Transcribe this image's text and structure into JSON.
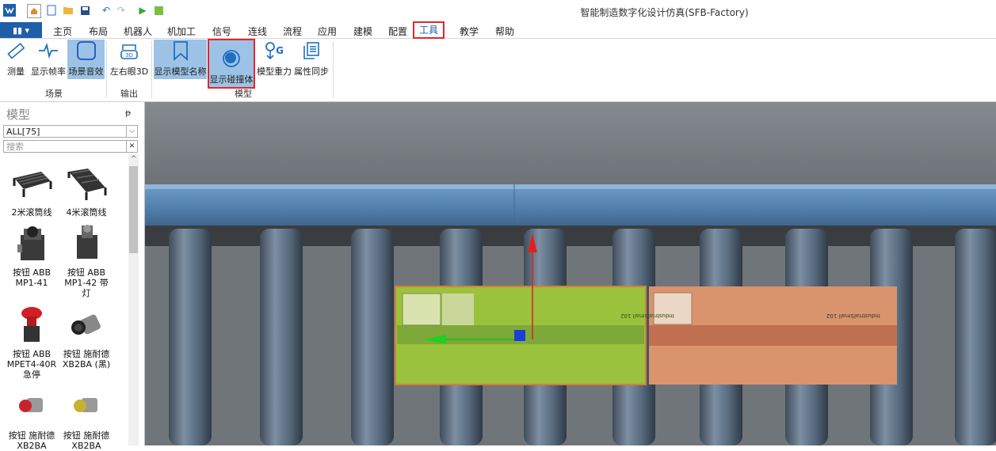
{
  "window": {
    "title": "智能制造数字化设计仿真(SFB-Factory)"
  },
  "quick_access": [
    "app-logo-icon",
    "home-icon",
    "new-icon",
    "open-icon",
    "save-icon",
    "undo-icon",
    "redo-icon",
    "play-icon",
    "stop-icon"
  ],
  "menu": {
    "app_button": "▮▮ ▾",
    "items": [
      "主页",
      "布局",
      "机器人",
      "机加工",
      "信号",
      "连线",
      "流程",
      "应用",
      "建模",
      "配置",
      "工具",
      "教学",
      "帮助"
    ],
    "active": "工具"
  },
  "ribbon": {
    "groups": [
      {
        "label": "场景",
        "buttons": [
          {
            "label": "测量",
            "icon": "ruler-icon"
          },
          {
            "label": "显示帧率",
            "icon": "pulse-icon"
          },
          {
            "label": "场景音效",
            "icon": "sound-box-icon",
            "selected": true
          }
        ]
      },
      {
        "label": "输出",
        "buttons": [
          {
            "label": "左右眼3D",
            "icon": "glasses-3d-icon"
          }
        ]
      },
      {
        "label": "模型",
        "buttons": [
          {
            "label": "显示模型名称",
            "icon": "bookmark-icon",
            "selected": true
          },
          {
            "label": "显示碰撞体",
            "icon": "collider-icon",
            "selected": true,
            "highlighted": true
          },
          {
            "label": "模型重力",
            "icon": "gravity-icon"
          },
          {
            "label": "属性同步",
            "icon": "sync-icon"
          }
        ]
      }
    ]
  },
  "panel": {
    "title": "模型",
    "pin": "ᵽ",
    "filter_value": "ALL[75]",
    "search_placeholder": "搜索",
    "clear": "✕",
    "items": [
      {
        "label": "2米滚筒线",
        "icon": "roller-conveyor-icon"
      },
      {
        "label": "4米滚筒线",
        "icon": "roller-conveyor-icon"
      },
      {
        "label": "按钮 ABB MP1-41",
        "icon": "push-button-icon"
      },
      {
        "label": "按钮 ABB MP1-42 带灯",
        "icon": "push-button-lamp-icon"
      },
      {
        "label": "按钮 ABB MPET4-40R 急停",
        "icon": "emergency-stop-icon"
      },
      {
        "label": "按钮 施耐德 XB2BA (黑)",
        "icon": "push-button-icon"
      },
      {
        "label": "按钮 施耐德 XB2BA",
        "icon": "push-button-red-icon"
      },
      {
        "label": "按钮 施耐德 XB2BA",
        "icon": "push-button-yellow-icon"
      }
    ]
  },
  "viewport": {
    "box_left": {
      "label": "IndustrialSmall 102",
      "state": "collider-shown",
      "color": "#9ac23c"
    },
    "box_right": {
      "label": "IndustrialSmall 102",
      "color": "#d9946d"
    },
    "gizmo": [
      "y-axis-arrow-red",
      "x-axis-arrow-green",
      "center-handle-blue"
    ]
  },
  "colors": {
    "accent": "#1f5fa8",
    "highlight_border": "#e5262e",
    "selected_bg": "#9cc3e6"
  }
}
